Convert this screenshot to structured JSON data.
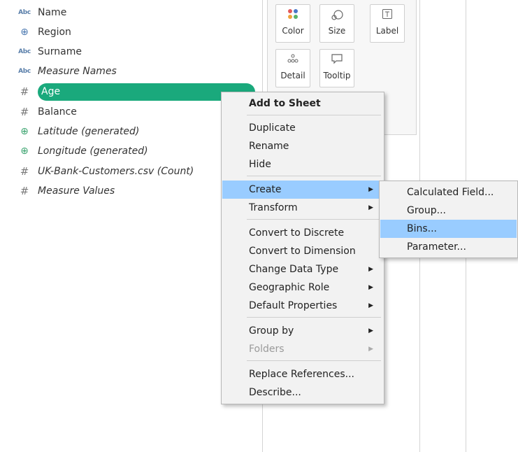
{
  "fields": [
    {
      "name": "Name",
      "type": "Abc",
      "style": "abc",
      "italic": false
    },
    {
      "name": "Region",
      "type": "⊕",
      "style": "dim",
      "italic": false
    },
    {
      "name": "Surname",
      "type": "Abc",
      "style": "abc",
      "italic": false
    },
    {
      "name": "Measure Names",
      "type": "Abc",
      "style": "abc",
      "italic": true
    },
    {
      "name": "Age",
      "type": "#",
      "style": "meas",
      "italic": false,
      "selected": true
    },
    {
      "name": "Balance",
      "type": "#",
      "style": "meas",
      "italic": false
    },
    {
      "name": "Latitude (generated)",
      "type": "⊕",
      "style": "geo",
      "italic": true
    },
    {
      "name": "Longitude (generated)",
      "type": "⊕",
      "style": "geo",
      "italic": true
    },
    {
      "name": "UK-Bank-Customers.csv (Count)",
      "type": "#",
      "style": "meas",
      "italic": true
    },
    {
      "name": "Measure Values",
      "type": "#",
      "style": "meas",
      "italic": true
    }
  ],
  "marks": {
    "color": "Color",
    "size": "Size",
    "label": "Label",
    "detail": "Detail",
    "tooltip": "Tooltip"
  },
  "context_menu": {
    "add_to_sheet": "Add to Sheet",
    "duplicate": "Duplicate",
    "rename": "Rename",
    "hide": "Hide",
    "create": "Create",
    "transform": "Transform",
    "convert_discrete": "Convert to Discrete",
    "convert_dimension": "Convert to Dimension",
    "change_data_type": "Change Data Type",
    "geographic_role": "Geographic Role",
    "default_properties": "Default Properties",
    "group_by": "Group by",
    "folders": "Folders",
    "replace_references": "Replace References...",
    "describe": "Describe..."
  },
  "create_submenu": {
    "calculated_field": "Calculated Field...",
    "group": "Group...",
    "bins": "Bins...",
    "parameter": "Parameter..."
  },
  "colors": {
    "selected_pill": "#1aa97c",
    "menu_highlight": "#99ccff"
  }
}
